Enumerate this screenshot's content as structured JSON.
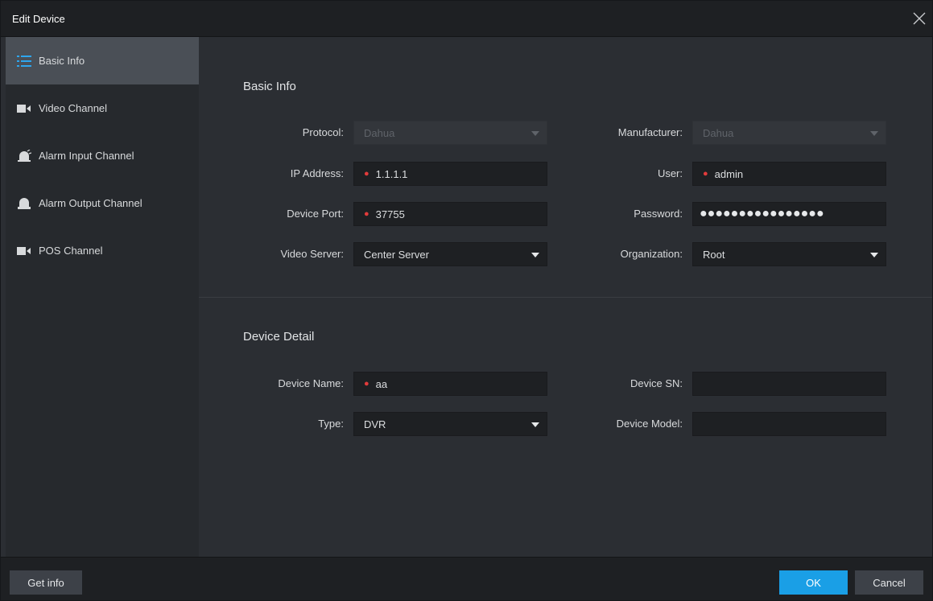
{
  "dialog": {
    "title": "Edit Device"
  },
  "sidebar": {
    "items": [
      {
        "label": "Basic Info",
        "icon": "list-icon",
        "active": true
      },
      {
        "label": "Video Channel",
        "icon": "video-camera-icon",
        "active": false
      },
      {
        "label": "Alarm Input Channel",
        "icon": "alarm-siren-icon",
        "active": false
      },
      {
        "label": "Alarm Output Channel",
        "icon": "alarm-bell-icon",
        "active": false
      },
      {
        "label": "POS Channel",
        "icon": "video-camera-icon",
        "active": false
      }
    ]
  },
  "basic_info": {
    "title": "Basic Info",
    "protocol": {
      "label": "Protocol:",
      "value": "Dahua",
      "disabled": true
    },
    "manufacturer": {
      "label": "Manufacturer:",
      "value": "Dahua",
      "disabled": true
    },
    "ip_address": {
      "label": "IP Address:",
      "value": "1.1.1.1",
      "required": true
    },
    "user": {
      "label": "User:",
      "value": "admin",
      "required": true
    },
    "device_port": {
      "label": "Device Port:",
      "value": "37755",
      "required": true
    },
    "password": {
      "label": "Password:",
      "value": "●●●●●●●●●●●●●●●●"
    },
    "video_server": {
      "label": "Video Server:",
      "value": "Center Server"
    },
    "organization": {
      "label": "Organization:",
      "value": "Root"
    }
  },
  "device_detail": {
    "title": "Device Detail",
    "device_name": {
      "label": "Device Name:",
      "value": "aa",
      "required": true
    },
    "device_sn": {
      "label": "Device SN:",
      "value": ""
    },
    "type": {
      "label": "Type:",
      "value": "DVR"
    },
    "device_model": {
      "label": "Device Model:",
      "value": ""
    }
  },
  "footer": {
    "get_info_label": "Get info",
    "ok_label": "OK",
    "cancel_label": "Cancel"
  },
  "colors": {
    "accent": "#1a9fe6",
    "required_marker": "#e23b3b",
    "active_nav": "#4a4f56",
    "icon_blue": "#2ea6ee"
  }
}
